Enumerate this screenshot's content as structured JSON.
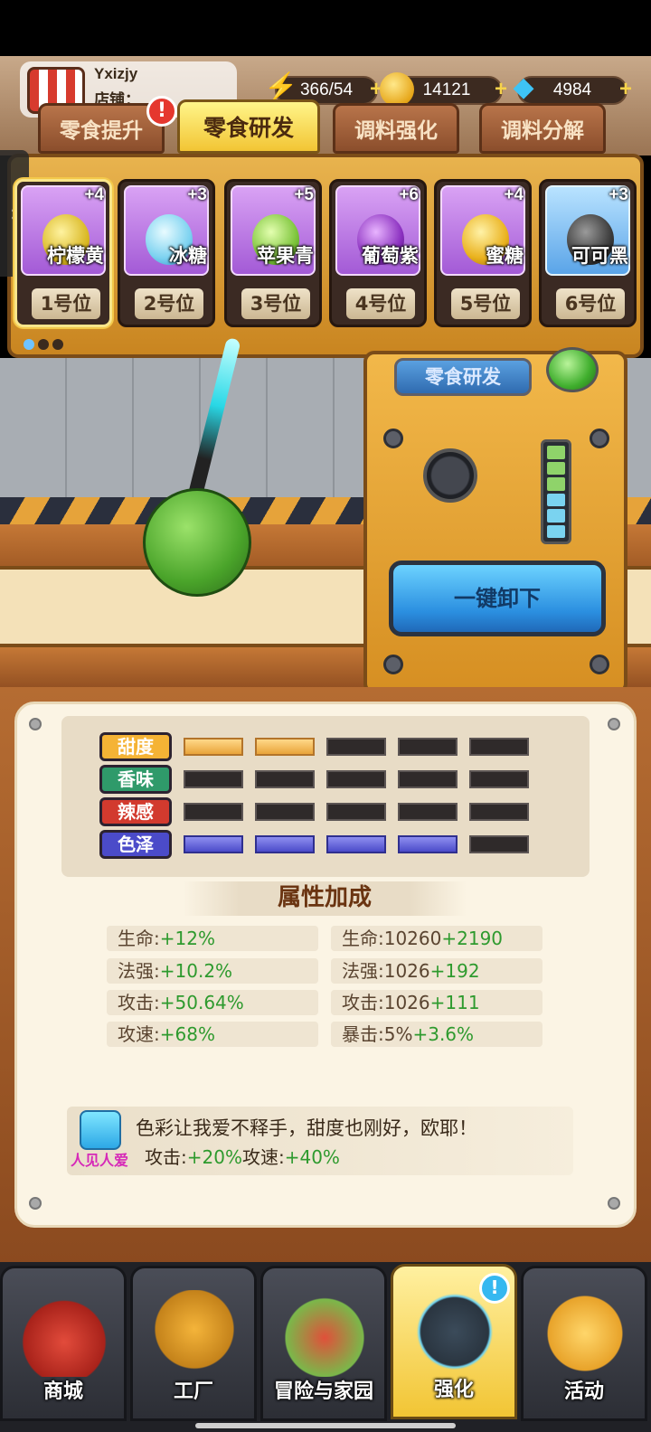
{
  "player": {
    "name": "Yxizjy",
    "shop_label": "店铺："
  },
  "resources": {
    "energy": "366/54",
    "gold": "14121",
    "gems": "4984"
  },
  "tabs": [
    {
      "label": "零食提升"
    },
    {
      "label": "零食研发"
    },
    {
      "label": "调料强化"
    },
    {
      "label": "调料分解"
    }
  ],
  "tab_badge": "!",
  "slots": [
    {
      "name": "柠檬黄",
      "level": "+4",
      "position": "1号位"
    },
    {
      "name": "冰糖",
      "level": "+3",
      "position": "2号位"
    },
    {
      "name": "苹果青",
      "level": "+5",
      "position": "3号位"
    },
    {
      "name": "葡萄紫",
      "level": "+6",
      "position": "4号位"
    },
    {
      "name": "蜜糖",
      "level": "+4",
      "position": "5号位"
    },
    {
      "name": "可可黑",
      "level": "+3",
      "position": "6号位"
    }
  ],
  "machine": {
    "label": "零食研发",
    "unload_button": "一键卸下"
  },
  "attributes": [
    {
      "label": "甜度",
      "level": 2,
      "max": 5,
      "color": "#f5b335"
    },
    {
      "label": "香味",
      "level": 0,
      "max": 5,
      "color": "#2f9a6a"
    },
    {
      "label": "辣感",
      "level": 0,
      "max": 5,
      "color": "#d23a2e"
    },
    {
      "label": "色泽",
      "level": 4,
      "max": 5,
      "color": "#4b4bc9"
    }
  ],
  "bonus": {
    "title": "属性加成",
    "left": [
      {
        "label": "生命:",
        "value": "+12%"
      },
      {
        "label": "法强:",
        "value": "+10.2%"
      },
      {
        "label": "攻击:",
        "value": "+50.64%"
      },
      {
        "label": "攻速:",
        "value": "+68%"
      }
    ],
    "right": [
      {
        "label": "生命:10260",
        "value": "+2190"
      },
      {
        "label": "法强:1026",
        "value": "+192"
      },
      {
        "label": "攻击:1026",
        "value": "+111"
      },
      {
        "label": "暴击:5%",
        "value": "+3.6%"
      }
    ]
  },
  "combo": {
    "tag": "人见人爱",
    "description": "色彩让我爱不释手，甜度也刚好，欧耶！",
    "bonus_label_1": "攻击:",
    "bonus_value_1": "+20%",
    "bonus_label_2": "攻速:",
    "bonus_value_2": "+40%"
  },
  "nav": [
    {
      "label": "商城",
      "icon": "shopping-cart-icon"
    },
    {
      "label": "工厂",
      "icon": "factory-icon"
    },
    {
      "label": "冒险与家园",
      "icon": "adventure-icon"
    },
    {
      "label": "强化",
      "icon": "enhance-icon"
    },
    {
      "label": "活动",
      "icon": "horn-icon"
    }
  ],
  "nav_badge": "!",
  "colors": {
    "accent_gold": "#f2c534",
    "stat_green": "#2e9a2e",
    "tag_magenta": "#d629b8"
  }
}
